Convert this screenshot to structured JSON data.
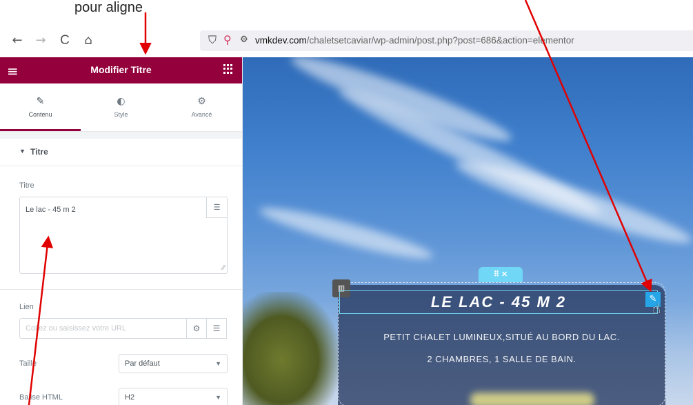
{
  "annotation": {
    "top_text": "pour aligne"
  },
  "browser": {
    "back": "←",
    "forward": "→",
    "reload": "C",
    "home": "⌂",
    "url_domain": "vmkdev.com",
    "url_path": "/chaletsetcaviar/wp-admin/post.php?post=6",
    "url_covered": "86",
    "url_tail": "&action=elementor"
  },
  "panel": {
    "title": "Modifier Titre",
    "tabs": [
      {
        "label": "Contenu"
      },
      {
        "label": "Style"
      },
      {
        "label": "Avancé"
      }
    ],
    "section": "Titre",
    "titre_label": "Titre",
    "titre_value": "Le lac - 45 m 2",
    "lien_label": "Lien",
    "lien_placeholder": "Collez ou saisissez votre URL",
    "taille_label": "Taille",
    "taille_value": "Par défaut",
    "balise_label": "Balise HTML",
    "balise_value": "H2"
  },
  "canvas": {
    "title": "LE LAC - 45 M 2",
    "line1": "PETIT CHALET LUMINEUX,SITUÉ AU BORD DU LAC.",
    "line2": "2 CHAMBRES, 1 SALLE DE BAIN."
  },
  "colors": {
    "panel_header": "#93003c",
    "selection": "#71d7f7",
    "edit_button": "#26a6e8",
    "arrow": "#e00000"
  }
}
